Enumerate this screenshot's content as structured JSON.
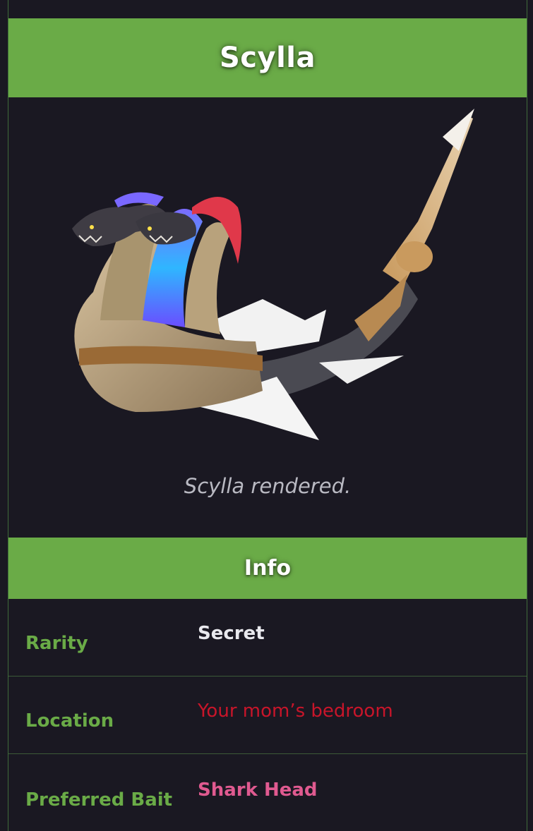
{
  "title": "Scylla",
  "image": {
    "caption": "Scylla rendered.",
    "icon": "scylla-creature-render"
  },
  "info": {
    "header": "Info",
    "rows": [
      {
        "label": "Rarity",
        "value": "Secret"
      },
      {
        "label": "Location",
        "value": "Your mom’s bedroom"
      },
      {
        "label": "Preferred Bait",
        "value": "Shark Head"
      }
    ]
  },
  "colors": {
    "header_green": "#6aab47",
    "background": "#1a1822",
    "label_green": "#6aab47",
    "secret_white": "#e9e9ee",
    "location_red": "#c8152a",
    "bait_pink": "#e05a90"
  }
}
